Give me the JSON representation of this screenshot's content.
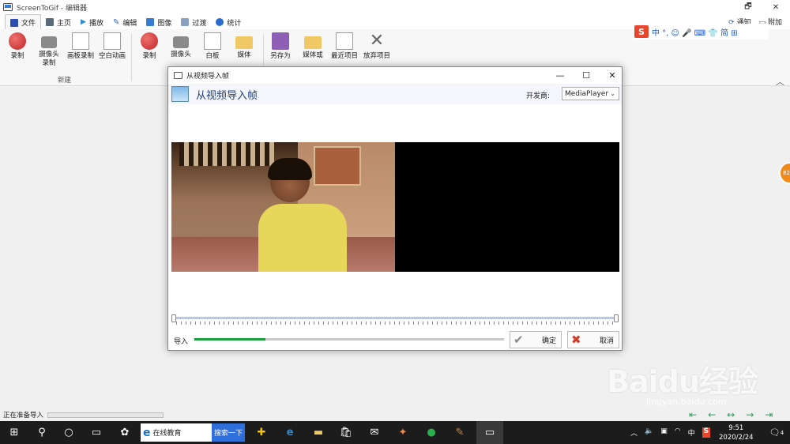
{
  "app": {
    "title": "ScreenToGif - 编辑器"
  },
  "window_controls": {
    "restore": "🗗",
    "close": "✕"
  },
  "tabs": [
    {
      "label": "文件",
      "icon": "save-icon",
      "color": "#2a4fb0"
    },
    {
      "label": "主页",
      "icon": "home-icon",
      "color": "#5a6b7a"
    },
    {
      "label": "播放",
      "icon": "play-icon",
      "color": "#2a8ad0"
    },
    {
      "label": "编辑",
      "icon": "pencil-icon",
      "color": "#2a6ab0"
    },
    {
      "label": "图像",
      "icon": "image-icon",
      "color": "#3a7bd5"
    },
    {
      "label": "过渡",
      "icon": "transition-icon",
      "color": "#5a8ab0"
    },
    {
      "label": "统计",
      "icon": "info-icon",
      "color": "#2a6ad0"
    }
  ],
  "right_buttons": {
    "notify": "通知",
    "attach": "附加"
  },
  "ime": {
    "logo": "S",
    "items": "中 °, ☺ 🎤 ⌨ 👕 简 ⊞"
  },
  "ribbon": {
    "group1": [
      {
        "label": "录制",
        "icon": "record-icon"
      },
      {
        "label": "摄像头录制",
        "icon": "webcam-icon"
      },
      {
        "label": "画板录制",
        "icon": "board-icon"
      },
      {
        "label": "空白动画",
        "icon": "blank-animation-icon"
      }
    ],
    "group1_label": "新建",
    "group2": [
      {
        "label": "录制",
        "icon": "record-icon"
      },
      {
        "label": "摄像头",
        "icon": "webcam-icon"
      },
      {
        "label": "白板",
        "icon": "board-icon"
      },
      {
        "label": "媒体",
        "icon": "media-folder-icon"
      }
    ],
    "group3": [
      {
        "label": "另存为",
        "icon": "save-as-icon"
      },
      {
        "label": "媒体或",
        "icon": "folder-icon"
      },
      {
        "label": "最近项目",
        "icon": "recent-icon"
      },
      {
        "label": "放弃项目",
        "icon": "discard-icon"
      }
    ]
  },
  "dialog": {
    "title": "从视频导入帧",
    "header_title": "从视频导入帧",
    "provider_label": "开发商:",
    "provider_value": "MediaPlayer",
    "import_label": "导入",
    "import_progress": 0.23,
    "ok_label": "确定",
    "cancel_label": "取消"
  },
  "status": {
    "text": "正在准备导入"
  },
  "taskbar": {
    "search_text": "在线教育",
    "search_button": "搜索一下",
    "ime_indicator": "中",
    "time": "9:51",
    "date": "2020/2/24",
    "notification_count": "4"
  },
  "watermark": {
    "text": "Baidu经验",
    "url": "jingyan.baidu.com"
  },
  "orange_badge": "82"
}
